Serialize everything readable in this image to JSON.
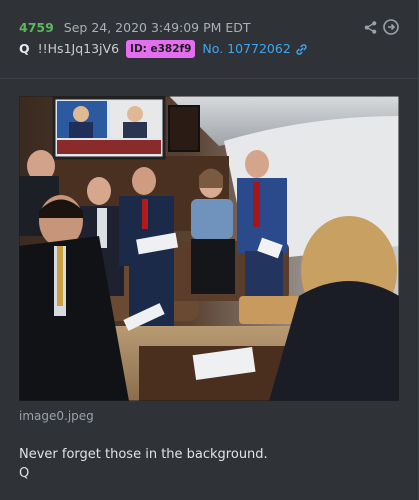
{
  "post": {
    "number": "4759",
    "date": "Sep 24, 2020 3:49:09 PM EDT",
    "author": "Q",
    "tripcode": "!!Hs1Jq13jV6",
    "id_badge": "ID: e382f9",
    "post_no": "No. 10772062"
  },
  "icons": {
    "share": "share-icon",
    "nav": "arrow-right-circle-icon",
    "link": "link-icon"
  },
  "attachment": {
    "filename": "image0.jpeg"
  },
  "message": {
    "line1": "Never forget those in the background.",
    "line2": "Q"
  },
  "colors": {
    "post_number": "#5cb85c",
    "id_badge": "#e36ef0",
    "link": "#3ea7ee"
  }
}
